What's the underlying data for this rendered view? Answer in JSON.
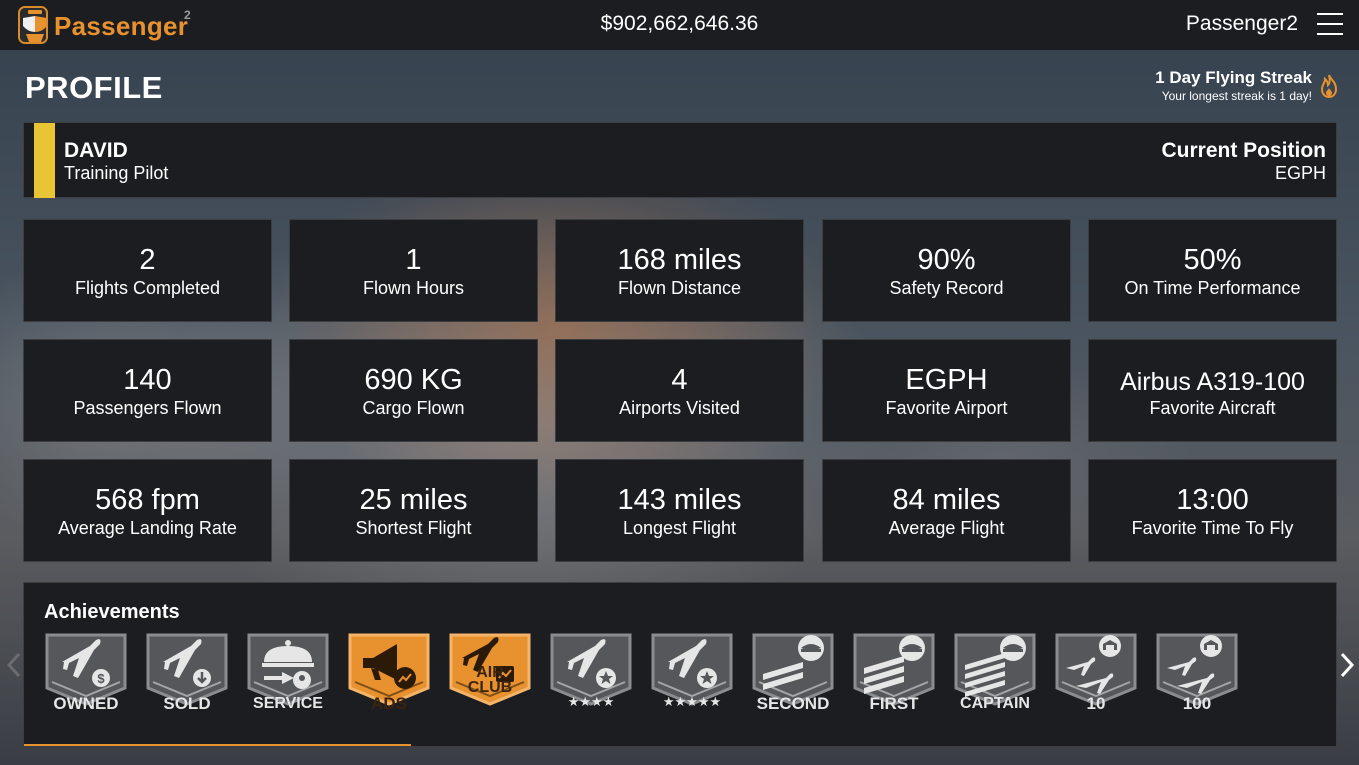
{
  "header": {
    "logo_text": "Passenger",
    "logo_sup": "2",
    "balance": "$902,662,646.36",
    "username": "Passenger2",
    "menu_icon": "hamburger-menu-icon"
  },
  "page": {
    "title": "PROFILE",
    "streak_title": "1 Day Flying Streak",
    "streak_sub": "Your longest streak is 1 day!",
    "streak_icon": "flame-icon"
  },
  "pilot": {
    "name": "DAVID",
    "rank": "Training Pilot",
    "position_label": "Current Position",
    "position_value": "EGPH",
    "stripe_color": "#e9c536"
  },
  "stats": [
    {
      "value": "2",
      "label": "Flights Completed"
    },
    {
      "value": "1",
      "label": "Flown Hours"
    },
    {
      "value": "168 miles",
      "label": "Flown Distance"
    },
    {
      "value": "90%",
      "label": "Safety Record"
    },
    {
      "value": "50%",
      "label": "On Time Performance"
    },
    {
      "value": "140",
      "label": "Passengers Flown"
    },
    {
      "value": "690 KG",
      "label": "Cargo Flown"
    },
    {
      "value": "4",
      "label": "Airports Visited"
    },
    {
      "value": "EGPH",
      "label": "Favorite Airport"
    },
    {
      "value": "Airbus A319-100",
      "label": "Favorite Aircraft"
    },
    {
      "value": "568 fpm",
      "label": "Average Landing Rate"
    },
    {
      "value": "25 miles",
      "label": "Shortest Flight"
    },
    {
      "value": "143 miles",
      "label": "Longest Flight"
    },
    {
      "value": "84 miles",
      "label": "Average Flight"
    },
    {
      "value": "13:00",
      "label": "Favorite Time To Fly"
    }
  ],
  "achievements": {
    "title": "Achievements",
    "accent_color": "#e8912f",
    "badges": [
      {
        "label": "OWNED",
        "icon": "plane-dollar-icon",
        "active": false
      },
      {
        "label": "SOLD",
        "icon": "plane-download-icon",
        "active": false
      },
      {
        "label": "SERVICE",
        "icon": "cloche-service-icon",
        "active": false
      },
      {
        "label": "ADS",
        "icon": "megaphone-icon",
        "active": true
      },
      {
        "label": "AIR",
        "label2": "CLUB",
        "icon": "plane-chart-icon",
        "active": true
      },
      {
        "label": "★★★★",
        "icon": "plane-star-icon",
        "active": false
      },
      {
        "label": "★★★★★",
        "icon": "plane-star-icon",
        "active": false
      },
      {
        "label": "SECOND",
        "icon": "pilot-cap-icon",
        "active": false
      },
      {
        "label": "FIRST",
        "icon": "pilot-cap-icon",
        "active": false
      },
      {
        "label": "CAPTAIN",
        "icon": "pilot-cap-icon",
        "active": false
      },
      {
        "label": "10",
        "icon": "hangar-planes-icon",
        "active": false
      },
      {
        "label": "100",
        "icon": "hangar-planes-icon",
        "active": false
      }
    ],
    "prev_icon": "chevron-left-icon",
    "next_icon": "chevron-right-icon"
  }
}
